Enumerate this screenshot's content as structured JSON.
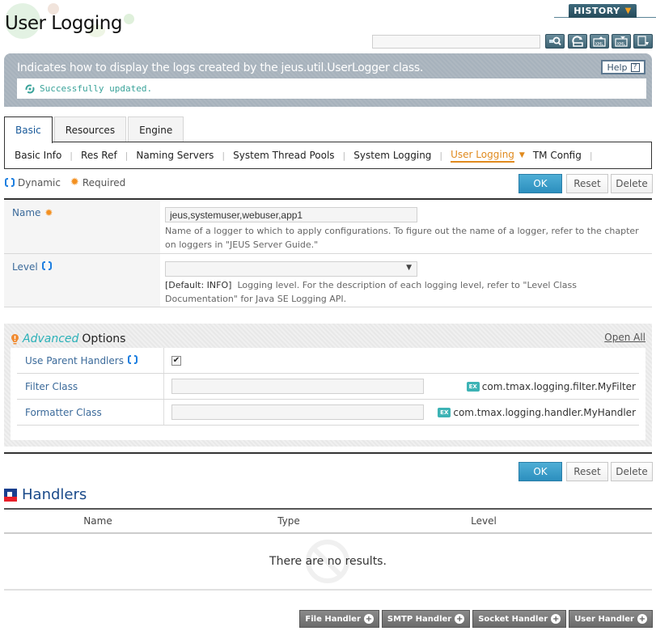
{
  "header": {
    "title": "User Logging",
    "history_label": "HISTORY",
    "search_placeholder": "",
    "tools": [
      "search-icon",
      "refresh-icon",
      "xml-export-icon",
      "xml-import-icon",
      "download-icon"
    ]
  },
  "description": {
    "text": "Indicates how to display the logs created by the jeus.util.UserLogger class.",
    "help_label": "Help",
    "help_icon": "?",
    "status_message": "Successfully updated."
  },
  "tabs": [
    {
      "label": "Basic",
      "active": true
    },
    {
      "label": "Resources",
      "active": false
    },
    {
      "label": "Engine",
      "active": false
    }
  ],
  "subnav": [
    {
      "label": "Basic Info"
    },
    {
      "label": "Res Ref"
    },
    {
      "label": "Naming Servers"
    },
    {
      "label": "System Thread Pools"
    },
    {
      "label": "System Logging"
    },
    {
      "label": "User Logging",
      "active": true
    },
    {
      "label": "TM Config"
    }
  ],
  "legend": {
    "dynamic": "Dynamic",
    "required": "Required"
  },
  "buttons": {
    "ok": "OK",
    "reset": "Reset",
    "delete": "Delete"
  },
  "form": {
    "name": {
      "label": "Name",
      "value": "jeus,systemuser,webuser,app1",
      "help": "Name of a logger to which to apply configurations. To figure out the name of a logger, refer to the chapter on loggers in \"JEUS Server Guide.\""
    },
    "level": {
      "label": "Level",
      "value": "",
      "default": "[Default: INFO]",
      "help": "Logging level. For the description of each logging level, refer to \"Level Class Documentation\" for Java SE Logging API."
    }
  },
  "advanced": {
    "title_italic": "Advanced",
    "title_rest": "Options",
    "open_all": "Open All",
    "use_parent_handlers": {
      "label": "Use Parent Handlers",
      "checked": true
    },
    "filter_class": {
      "label": "Filter Class",
      "value": "",
      "example_badge": "EX",
      "example": "com.tmax.logging.filter.MyFilter"
    },
    "formatter_class": {
      "label": "Formatter Class",
      "value": "",
      "example_badge": "EX",
      "example": "com.tmax.logging.handler.MyHandler"
    }
  },
  "handlers": {
    "title": "Handlers",
    "columns": [
      "Name",
      "Type",
      "Level"
    ],
    "rows": [],
    "empty_message": "There are no results.",
    "add_buttons": [
      "File Handler",
      "SMTP Handler",
      "Socket Handler",
      "User Handler"
    ]
  }
}
